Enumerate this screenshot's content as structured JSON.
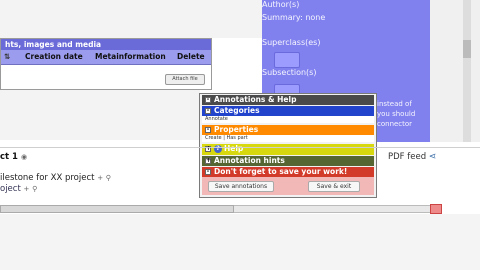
{
  "right_panel": {
    "author": "Author(s)",
    "summary": "Summary: none",
    "superclass": "Superclass(es)",
    "subsection": "Subsection(s)",
    "note_lines": [
      "instead of",
      "you should",
      "connector"
    ]
  },
  "attachments": {
    "title": "hts, images and media",
    "columns": [
      "Creation date",
      "Metainformation",
      "Delete"
    ],
    "attach_button": "Attach file"
  },
  "popup": {
    "title": "Annotations & Help",
    "categories_label": "Categories",
    "categories_sub": "Annotate",
    "properties_label": "Properties",
    "properties_sub": "Create | Has part",
    "help_label": "Help",
    "hints_label": "Annotation hints",
    "warning_label": "Don't forget to save your work!",
    "save_annotations": "Save annotations",
    "save_exit": "Save & exit"
  },
  "content": {
    "project_title": "ct 1",
    "milestone_text": "ilestone for XX project",
    "project_link": "oject",
    "pdf_feed": "PDF feed"
  },
  "colors": {
    "purple": "#8080ee",
    "categories": "#2244cc",
    "properties": "#ff8a00",
    "help": "#d8d80e",
    "hints": "#556633",
    "warning": "#d23a2a"
  }
}
